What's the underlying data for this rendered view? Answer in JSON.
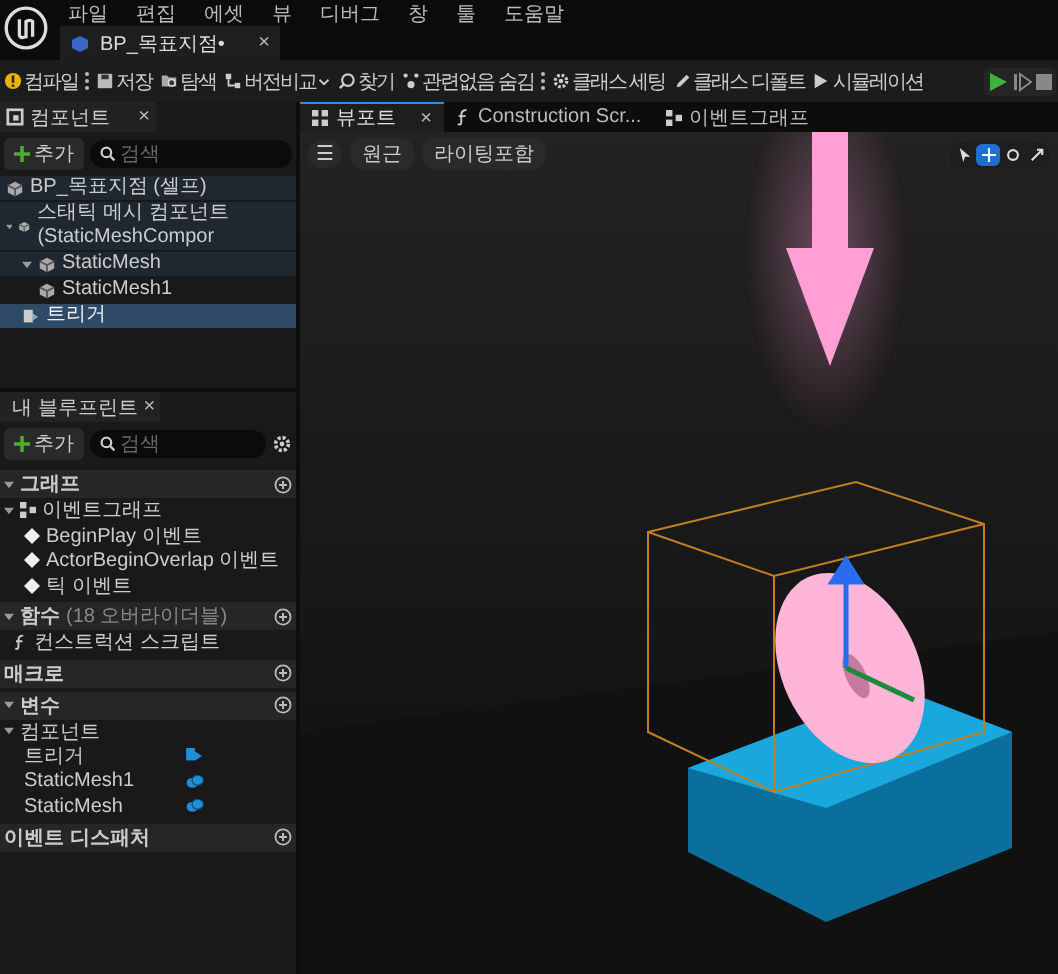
{
  "menu": [
    "파일",
    "편집",
    "에셋",
    "뷰",
    "디버그",
    "창",
    "툴",
    "도움말"
  ],
  "doc_tab": {
    "title": "BP_목표지점•",
    "close": "×",
    "selected": true
  },
  "toolbar": [
    {
      "kind": "compile",
      "label": "컴파일"
    },
    {
      "kind": "save",
      "label": "저장"
    },
    {
      "kind": "browse",
      "label": "탐색"
    },
    {
      "kind": "diff",
      "label": "버전비교"
    },
    {
      "kind": "find",
      "label": "찾기"
    },
    {
      "kind": "hide",
      "label": "관련없음 숨김"
    },
    {
      "kind": "settings",
      "label": "클래스 세팅"
    },
    {
      "kind": "defaults",
      "label": "클래스 디폴트"
    },
    {
      "kind": "simulate",
      "label": "시뮬레이션"
    }
  ],
  "components": {
    "title": "컴포넌트",
    "close": "×",
    "add": "추가",
    "search_placeholder": "검색",
    "tree": [
      {
        "label": "BP_목표지점 (셀프)",
        "selected": false
      },
      {
        "label": "스태틱 메시 컴포넌트 (StaticMeshCompor",
        "selected": false,
        "expanded": true,
        "children": [
          {
            "label": "StaticMesh",
            "selected": false,
            "expanded": true,
            "children": [
              {
                "label": "StaticMesh1",
                "selected": false
              }
            ]
          },
          {
            "label": "트리거",
            "selected": true,
            "kind": "trigger"
          }
        ]
      }
    ]
  },
  "blueprint": {
    "title": "내 블루프린트",
    "close": "×",
    "add": "추가",
    "search_placeholder": "검색",
    "sections": [
      {
        "title": "그래프",
        "expanded": true,
        "items": [
          {
            "kind": "graph",
            "label": "이벤트그래프"
          },
          {
            "kind": "event",
            "label": "BeginPlay 이벤트"
          },
          {
            "kind": "event",
            "label": "ActorBeginOverlap 이벤트"
          },
          {
            "kind": "event",
            "label": "틱 이벤트"
          }
        ]
      },
      {
        "title": "함수",
        "expanded": true,
        "note": "(18 오버라이더블)",
        "items": [
          {
            "kind": "function",
            "label": "컨스트럭션 스크립트"
          }
        ]
      },
      {
        "title": "매크로"
      },
      {
        "title": "변수",
        "expanded": true,
        "items": [
          {
            "kind": "category",
            "label": "컴포넌트"
          },
          {
            "kind": "trigger_var",
            "label": "트리거"
          },
          {
            "kind": "mesh_var",
            "label": "StaticMesh1"
          },
          {
            "kind": "mesh_var",
            "label": "StaticMesh"
          }
        ]
      },
      {
        "title": "이벤트 디스패처"
      }
    ]
  },
  "viewport": {
    "tabs": [
      {
        "label": "뷰포트",
        "selected": true,
        "close": "×",
        "kind": "viewport"
      },
      {
        "label": "Construction Scr...",
        "selected": false,
        "kind": "function"
      },
      {
        "label": "이벤트그래프",
        "selected": false,
        "kind": "graph"
      }
    ],
    "menu_icon": "☰",
    "view_buttons": [
      "원근",
      "라이팅포함"
    ],
    "tools": [
      {
        "kind": "select",
        "selected": false
      },
      {
        "kind": "move",
        "selected": true
      },
      {
        "kind": "rotate",
        "selected": false
      },
      {
        "kind": "scale",
        "selected": false
      }
    ]
  }
}
